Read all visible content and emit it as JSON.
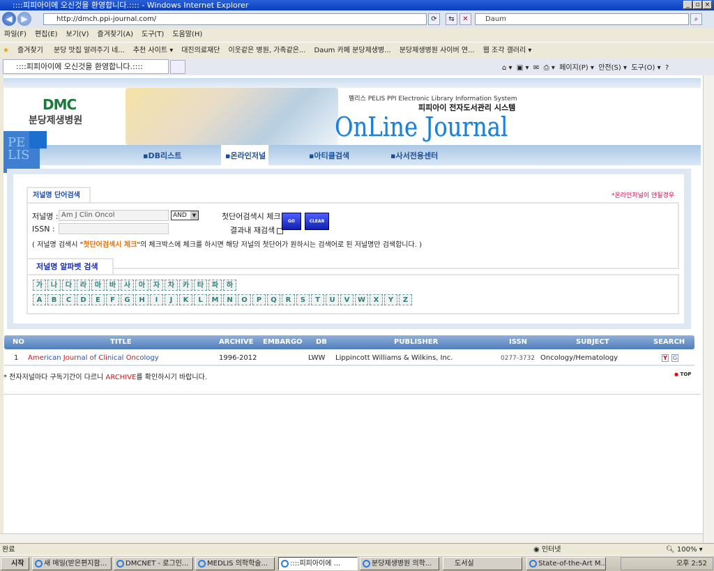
{
  "window": {
    "title": "::::피피아이에 오신것을 환영합니다.:::: - Windows Internet Explorer"
  },
  "browser": {
    "address": "http://dmch.ppi-journal.com/",
    "search_placeholder": "Daum",
    "menu": [
      "파일(F)",
      "편집(E)",
      "보기(V)",
      "즐겨찾기(A)",
      "도구(T)",
      "도움말(H)"
    ],
    "favorites_label": "즐겨찾기",
    "favorites": [
      "분당 맛집 알려주기 네...",
      "추천 사이트 ▾",
      "대진의료재단",
      "이웃같은 병원, 가족같은...",
      "Daum 카페 분당제생병...",
      "분당제생병원 사이버 연...",
      "웹 조각 갤러리 ▾"
    ],
    "tab": "::::피피아이에 오신것을 환영합니다.::::",
    "commands": [
      "페이지(P) ▾",
      "안전(S) ▾",
      "도구(O) ▾"
    ],
    "status": "완료",
    "zone": "인터넷",
    "zoom": "100%"
  },
  "header": {
    "logo_mark": "DMC",
    "logo_text": "분당제생병원",
    "pelis_sub": "펠리스 PELIS PPI Electronic Library Information System",
    "pelis_title": "피피아이 전자도서관리 시스템",
    "banner_title": "OnLine Journal",
    "side_logo": "PELIS",
    "nav": [
      "DB리스트",
      "온라인저널",
      "아티클검색",
      "사서전용센터"
    ],
    "active_nav": "온라인저널"
  },
  "search": {
    "tab": "저널명 단어검색",
    "notice": "*온라인저널이 안될경우",
    "journal_label": "저널명 :",
    "journal_value": "Am J Clin Oncol",
    "operator": "AND",
    "issn_label": "ISSN :",
    "issn_value": "",
    "first_word_check": "첫단어검색시 체크",
    "within_results": "결과내 재검색",
    "go": "GO",
    "clear": "CLEAR",
    "help_pre": "( 저널명 검색시 \"",
    "help_em": "첫단어검색시 체크",
    "help_post": "\"의 체크박스에 체크를 하시면 해당 저널의 첫단어가 원하시는 검색어로 된 저널명만 검색합니다. )"
  },
  "alphabet": {
    "tab": "저널명 알파벳 검색",
    "korean": [
      "가",
      "나",
      "다",
      "라",
      "마",
      "바",
      "사",
      "아",
      "자",
      "차",
      "카",
      "타",
      "파",
      "하"
    ],
    "latin": [
      "A",
      "B",
      "C",
      "D",
      "E",
      "F",
      "G",
      "H",
      "I",
      "J",
      "K",
      "L",
      "M",
      "N",
      "O",
      "P",
      "Q",
      "R",
      "S",
      "T",
      "U",
      "V",
      "W",
      "X",
      "Y",
      "Z"
    ]
  },
  "table": {
    "headers": [
      "NO",
      "TITLE",
      "ARCHIVE",
      "EMBARGO",
      "DB",
      "PUBLISHER",
      "ISSN",
      "SUBJECT",
      "SEARCH"
    ],
    "rows": [
      {
        "no": "1",
        "title": "American Journal of Clinical Oncology",
        "archive": "1996-2012",
        "embargo": "",
        "db": "LWW",
        "publisher": "Lippincott Williams & Wilkins, Inc.",
        "issn": "0277-3732",
        "subject": "Oncology/Hematology",
        "search": [
          "Y",
          "G"
        ]
      }
    ]
  },
  "footer": {
    "note_pre": "* 전자저널마다 구독기간이 다르니 ",
    "note_em": "ARCHIVE",
    "note_post": "를 확인하시기 바랍니다.",
    "top": "TOP"
  },
  "taskbar": {
    "start": "시작",
    "tasks": [
      "새 메일(받은편지함...",
      "DMCNET - 로그인...",
      "MEDLIS 의학학술...",
      "::::피피아이에 ...",
      "분당제생병원 의학...",
      "도서실",
      "State-of-the-Art M..."
    ],
    "clock": "오후 2:52"
  },
  "colors": {
    "accent": "#1a4fb0",
    "highlight": "#e01010",
    "table_header": "#5a86c2"
  }
}
